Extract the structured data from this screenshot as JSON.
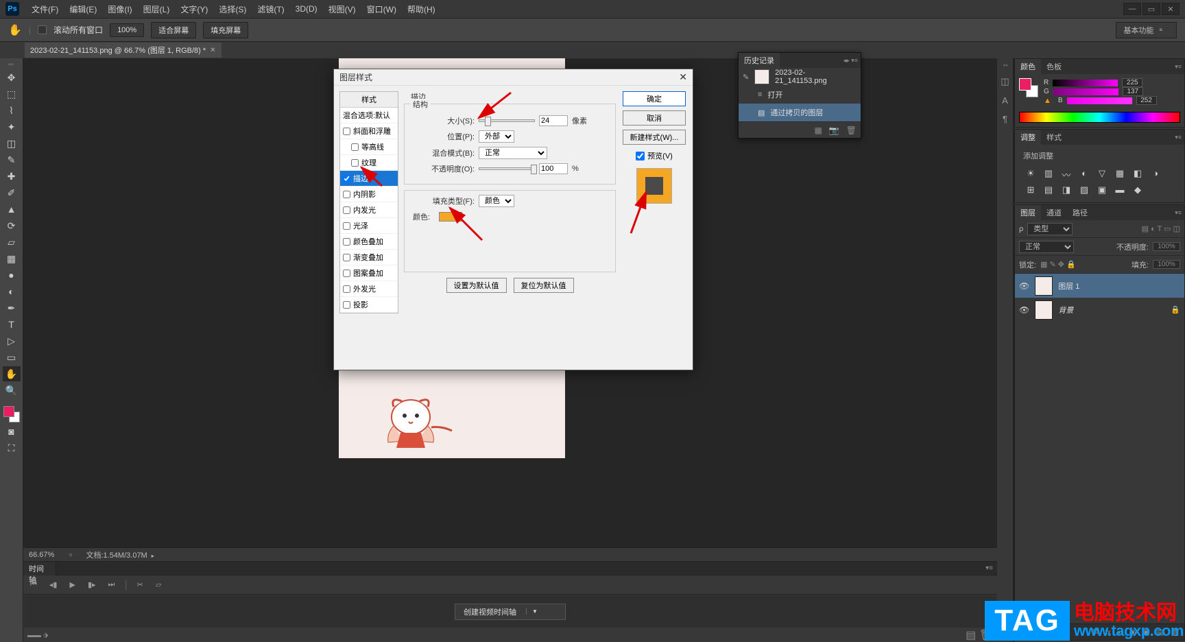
{
  "menu": {
    "items": [
      "文件(F)",
      "编辑(E)",
      "图像(I)",
      "图层(L)",
      "文字(Y)",
      "选择(S)",
      "滤镜(T)",
      "3D(D)",
      "视图(V)",
      "窗口(W)",
      "帮助(H)"
    ]
  },
  "options": {
    "scroll_all": "滚动所有窗口",
    "zoom_pct": "100%",
    "fit_screen": "适合屏幕",
    "fill_screen": "填充屏幕",
    "workspace": "基本功能"
  },
  "doc_tab": "2023-02-21_141153.png @ 66.7% (图层 1, RGB/8) *",
  "status": {
    "zoom": "66.67%",
    "doc_info": "文档:1.54M/3.07M"
  },
  "timeline": {
    "tab": "时间轴",
    "create": "创建视频时间轴"
  },
  "history": {
    "tab": "历史记录",
    "file": "2023-02-21_141153.png",
    "items": [
      "打开",
      "通过拷贝的图层"
    ]
  },
  "color": {
    "tabs": [
      "颜色",
      "色板"
    ],
    "r": "225",
    "g": "137",
    "b": "252"
  },
  "adjust": {
    "tabs": [
      "调整",
      "样式"
    ],
    "label": "添加调整"
  },
  "layers": {
    "tabs": [
      "图层",
      "通道",
      "路径"
    ],
    "type_label": "类型",
    "blend": "正常",
    "opacity_label": "不透明度:",
    "opacity": "100%",
    "lock_label": "锁定:",
    "fill_label": "填充:",
    "fill": "100%",
    "items": [
      {
        "name": "图层 1"
      },
      {
        "name": "背景"
      }
    ]
  },
  "dialog": {
    "title": "图层样式",
    "style_header": "样式",
    "blend_default": "混合选项:默认",
    "styles": [
      {
        "label": "斜面和浮雕",
        "checked": false
      },
      {
        "label": "等高线",
        "checked": false,
        "indent": true
      },
      {
        "label": "纹理",
        "checked": false,
        "indent": true
      },
      {
        "label": "描边",
        "checked": true,
        "sel": true
      },
      {
        "label": "内阴影",
        "checked": false
      },
      {
        "label": "内发光",
        "checked": false
      },
      {
        "label": "光泽",
        "checked": false
      },
      {
        "label": "颜色叠加",
        "checked": false
      },
      {
        "label": "渐变叠加",
        "checked": false
      },
      {
        "label": "图案叠加",
        "checked": false
      },
      {
        "label": "外发光",
        "checked": false
      },
      {
        "label": "投影",
        "checked": false
      }
    ],
    "section": {
      "stroke_label": "描边",
      "structure": "结构",
      "size_label": "大小(S):",
      "size_value": "24",
      "size_unit": "像素",
      "position_label": "位置(P):",
      "position_value": "外部",
      "blend_label": "混合模式(B):",
      "blend_value": "正常",
      "opacity_label": "不透明度(O):",
      "opacity_value": "100",
      "filltype_group": "填充类型(F):",
      "filltype_value": "颜色",
      "color_label": "颜色:",
      "btn_default": "设置为默认值",
      "btn_reset": "复位为默认值"
    },
    "btns": {
      "ok": "确定",
      "cancel": "取消",
      "new_style": "新建样式(W)...",
      "preview": "预览(V)"
    }
  },
  "watermark": {
    "tag": "TAG",
    "cn": "电脑技术网",
    "url": "www.tagxp.com"
  }
}
